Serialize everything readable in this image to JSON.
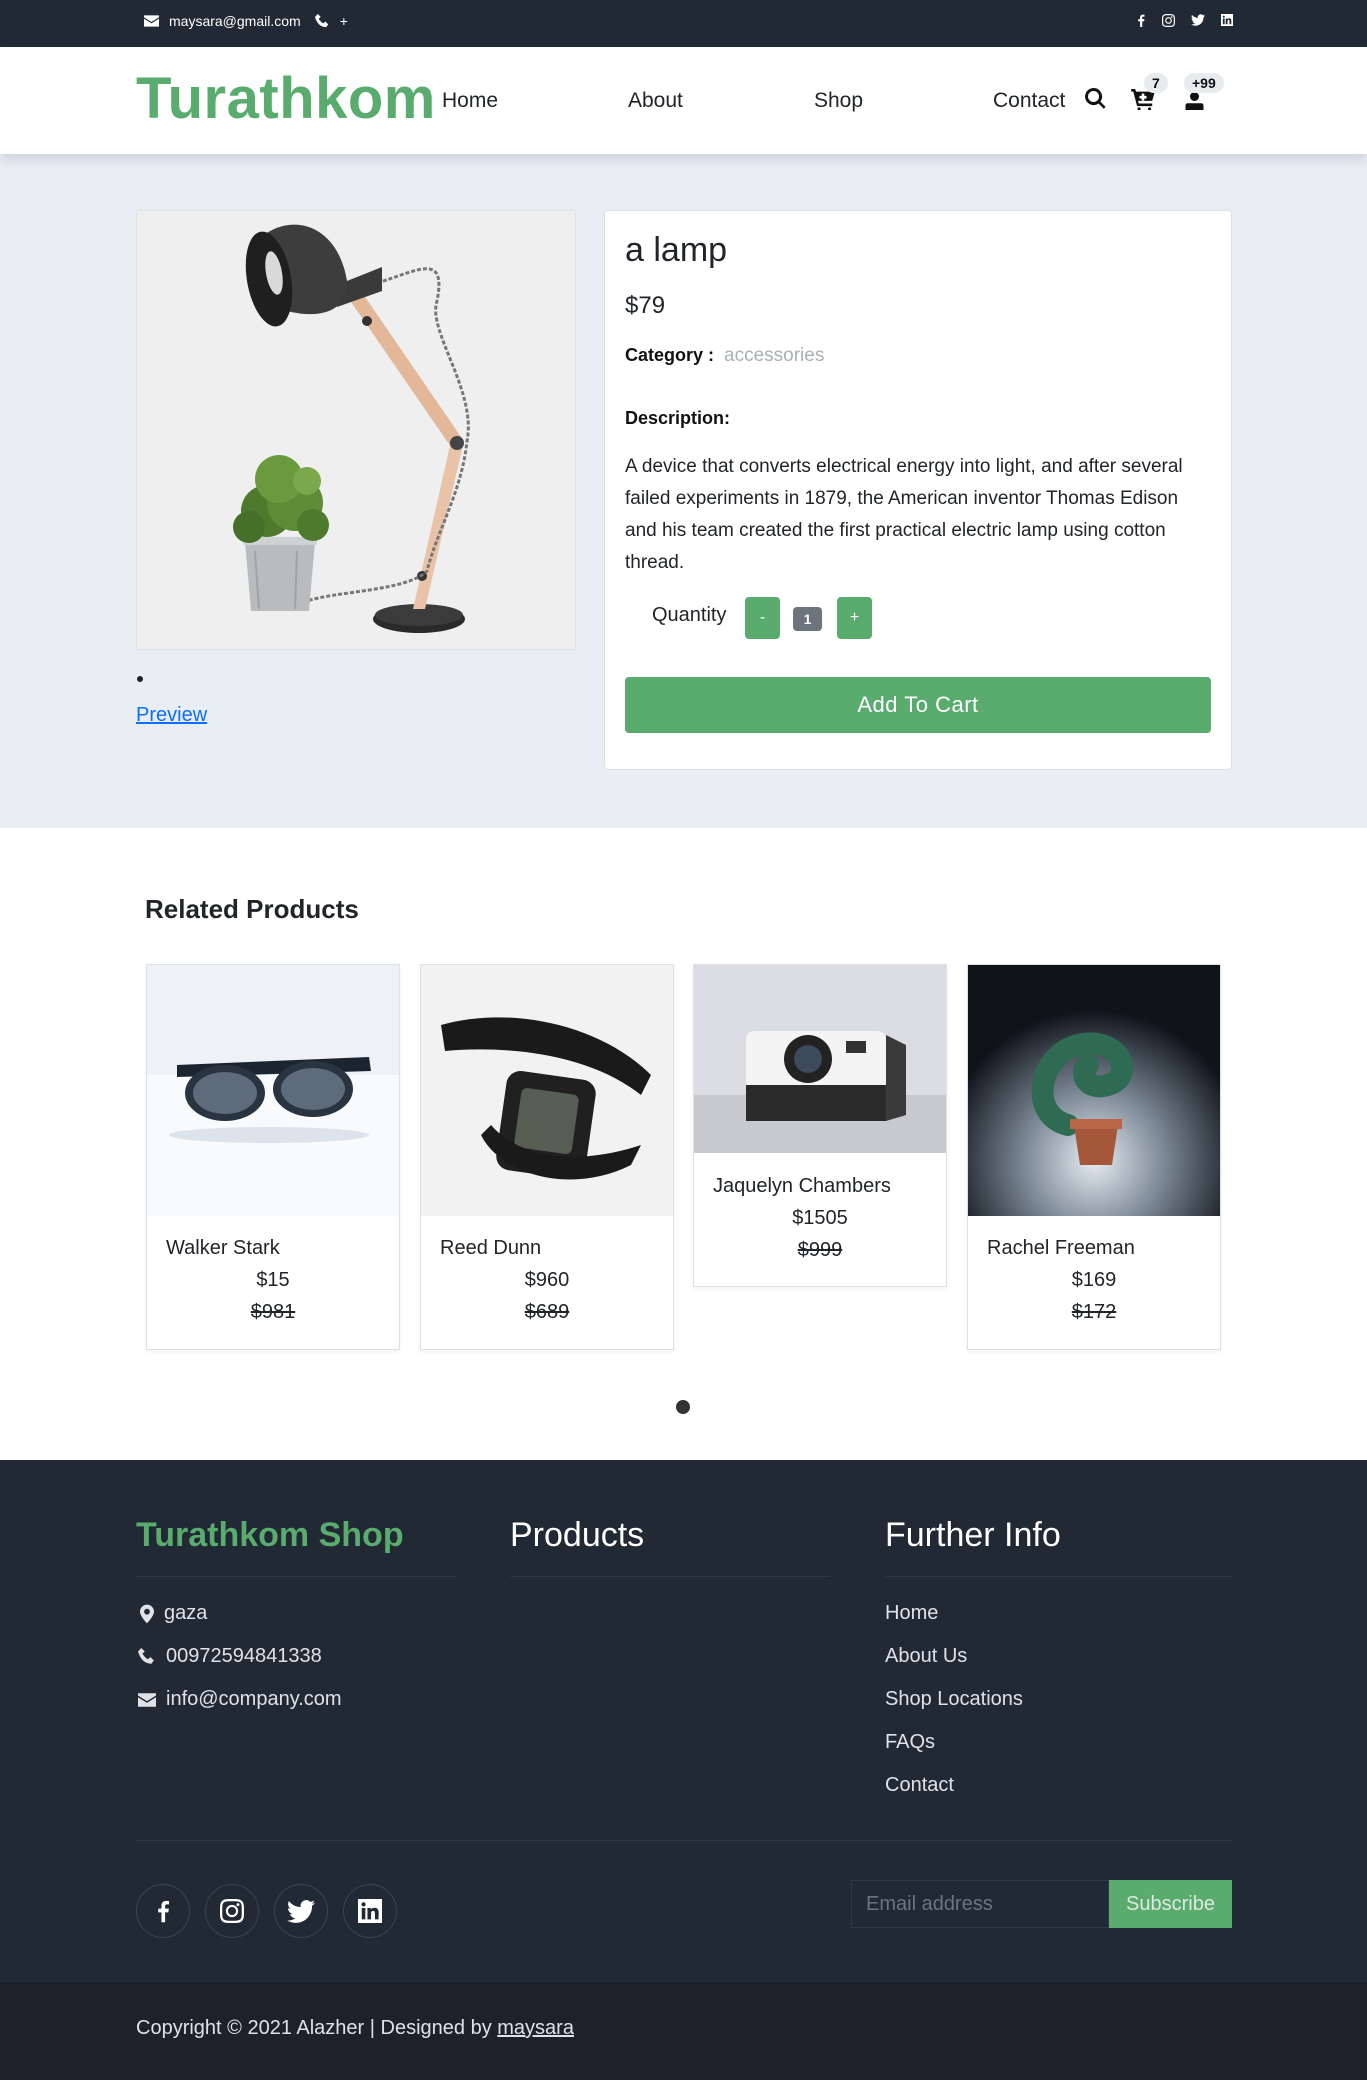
{
  "topbar": {
    "email": "maysara@gmail.com",
    "phone": "+",
    "social_icons": [
      "facebook-icon",
      "instagram-icon",
      "twitter-icon",
      "linkedin-icon"
    ]
  },
  "nav": {
    "logo": "Turathkom",
    "links": [
      "Home",
      "About",
      "Shop",
      "Contact"
    ],
    "cart_count": "7",
    "user_count": "+99"
  },
  "product": {
    "title": "a lamp",
    "price": "$79",
    "category_label": "Category :",
    "category_value": "accessories",
    "description_label": "Description:",
    "description": "A device that converts electrical energy into light, and after several failed experiments in 1879, the American inventor Thomas Edison and his team created the first practical electric lamp using cotton thread.",
    "quantity_label": "Quantity",
    "quantity_minus": "-",
    "quantity_value": "1",
    "quantity_plus": "+",
    "add_to_cart": "Add To Cart",
    "preview_link": "Preview"
  },
  "related": {
    "title": "Related Products",
    "items": [
      {
        "name": "Walker Stark",
        "price": "$15",
        "old_price": "$981"
      },
      {
        "name": "Reed Dunn",
        "price": "$960",
        "old_price": "$689"
      },
      {
        "name": "Jaquelyn Chambers",
        "price": "$1505",
        "old_price": "$999"
      },
      {
        "name": "Rachel Freeman",
        "price": "$169",
        "old_price": "$172"
      }
    ]
  },
  "footer": {
    "brand": "Turathkom Shop",
    "products_heading": "Products",
    "info_heading": "Further Info",
    "address": "gaza",
    "phone": "00972594841338",
    "email": "info@company.com",
    "info_links": [
      "Home",
      "About Us",
      "Shop Locations",
      "FAQs",
      "Contact"
    ],
    "email_placeholder": "Email address",
    "subscribe": "Subscribe",
    "copyright_prefix": "Copyright © 2021 Alazher | Designed by",
    "copyright_author": "maysara"
  },
  "colors": {
    "brand_green": "#59ab6e",
    "dark_bg": "#212934",
    "light_bg": "#e9edf4"
  }
}
